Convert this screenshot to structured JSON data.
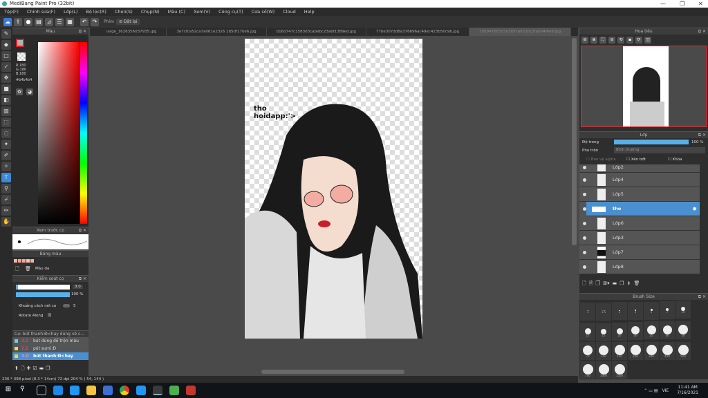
{
  "app": {
    "title": "MediBang Paint Pro (32bit)"
  },
  "menu": [
    "Tệp(F)",
    "Chỉnh sửa(F)",
    "Lớp(L)",
    "Bộ lọc(R)",
    "Chọn(S)",
    "Chụp(N)",
    "Màu (C)",
    "Xem(V)",
    "Công cụ(T)",
    "Cửa sổ(W)",
    "Cloud",
    "Help"
  ],
  "toolbar": {
    "key_label": "Phím",
    "reset_label": "Đặt lại"
  },
  "tabs": [
    "large_1626356037935.jpg",
    "3e7cfca52ca7a061e2326 1b5df170e6.jpg",
    "b16d747c158303cabebc23abf1389ed.jpg",
    "77be307dd8a376696ac49ec423b50c9b.jpg",
    "7859476f2fc5a3b57a622bc2fa004f4e9.jpg"
  ],
  "color_panel": {
    "title": "Màu",
    "r": "R:180",
    "g": "G:180",
    "b": "B:180",
    "hex": "#b4b4b4",
    "accent": "#e02020"
  },
  "brush_preview": {
    "title": "Xem trước cọ"
  },
  "palette": {
    "title": "Bảng màu",
    "name": "Màu da",
    "swatches": [
      "#f4b8a8",
      "#f2a090",
      "#f0a898",
      "#f6c0b0",
      "#f4b0a0"
    ]
  },
  "brush_control": {
    "title": "Kiểm soát cọ",
    "size": "3.0",
    "opacity": "100 %",
    "opacity_value": 100,
    "spacing_label": "Khoảng cách nét cọ",
    "spacing_value": "5",
    "rotate_label": "Rotate Along"
  },
  "brush_list": {
    "title": "Cọ: bút thanh:Đ<hay dùng vẽ c...",
    "items": [
      {
        "size": "3.2",
        "name": "bút dùng để trộn màu",
        "color": "#6ad0f0"
      },
      {
        "size": "2.2",
        "name": "pút sumi:Đ",
        "color": "#f0e020"
      },
      {
        "size": "3.0",
        "name": "bút thanh:Đ<hay",
        "color": "#f0e020",
        "selected": true
      }
    ]
  },
  "status": {
    "text": "236 * 398 pixel   (8.3 * 14cm)   72 dpi   204 %   ( 54, 144 )"
  },
  "navigator": {
    "title": "Hoa tiêu"
  },
  "layers_panel": {
    "title": "Lớp",
    "opacity_label": "Độ trong",
    "opacity": "100 %",
    "opacity_value": 100,
    "blend_label": "Pha trộn",
    "blend_value": "Bình thường",
    "protect_alpha": "Bảo vệ alpha",
    "clipping": "Xén bớt",
    "lock": "Khóa",
    "layers": [
      {
        "name": "Lớp2"
      },
      {
        "name": "Lớp4"
      },
      {
        "name": "Lớp5"
      },
      {
        "name": "tho",
        "selected": true
      },
      {
        "name": "Lớp6"
      },
      {
        "name": "Lớp3"
      },
      {
        "name": "Lớp7"
      },
      {
        "name": "Lớp8"
      }
    ]
  },
  "brush_size": {
    "title": "Brush Size",
    "sizes": [
      "1",
      "1.5",
      "2",
      "3",
      "5",
      "7",
      "10",
      "15",
      "15",
      "20",
      "30",
      "35",
      "40",
      "50",
      "70",
      "100",
      "150",
      "200",
      "300",
      "400",
      "500",
      "700",
      "1000",
      "1500"
    ]
  },
  "canvas": {
    "text_line1": "tho",
    "text_line2": "hoidapp:'>"
  },
  "taskbar": {
    "time": "11:41 AM",
    "date": "7/16/2021",
    "lang": "VIE"
  }
}
